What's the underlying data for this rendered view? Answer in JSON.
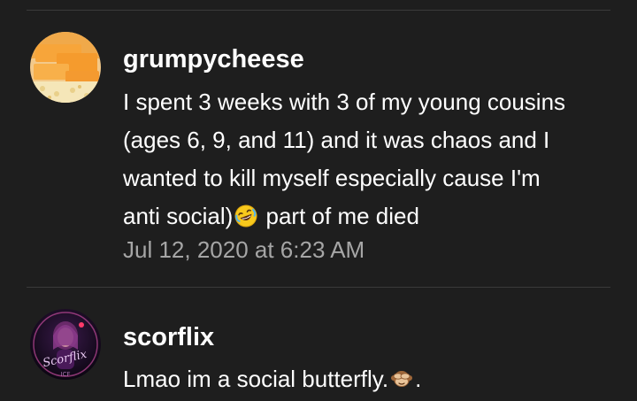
{
  "comments": [
    {
      "username": "grumpycheese",
      "text_lines": [
        "I spent 3 weeks with 3 of my young cousins",
        "(ages 6, 9, and 11) and it was chaos and I",
        "wanted to kill myself especially cause I'm",
        "anti social)",
        " part of me died"
      ],
      "emoji": "rolling-on-floor-laughing-emoji",
      "timestamp": "Jul 12, 2020 at 6:23 AM",
      "avatar": "cheese-avatar"
    },
    {
      "username": "scorflix",
      "text_before_emoji": "Lmao im a social butterfly.",
      "text_after_emoji": ".",
      "emoji": "see-no-evil-monkey-emoji",
      "avatar": "scorflix-avatar",
      "avatar_text": "Scorflix"
    }
  ],
  "colors": {
    "background": "#1e1e1e",
    "divider": "#3a3a3a",
    "username": "#ffffff",
    "text": "#ffffff",
    "timestamp": "#a6a6a6"
  }
}
